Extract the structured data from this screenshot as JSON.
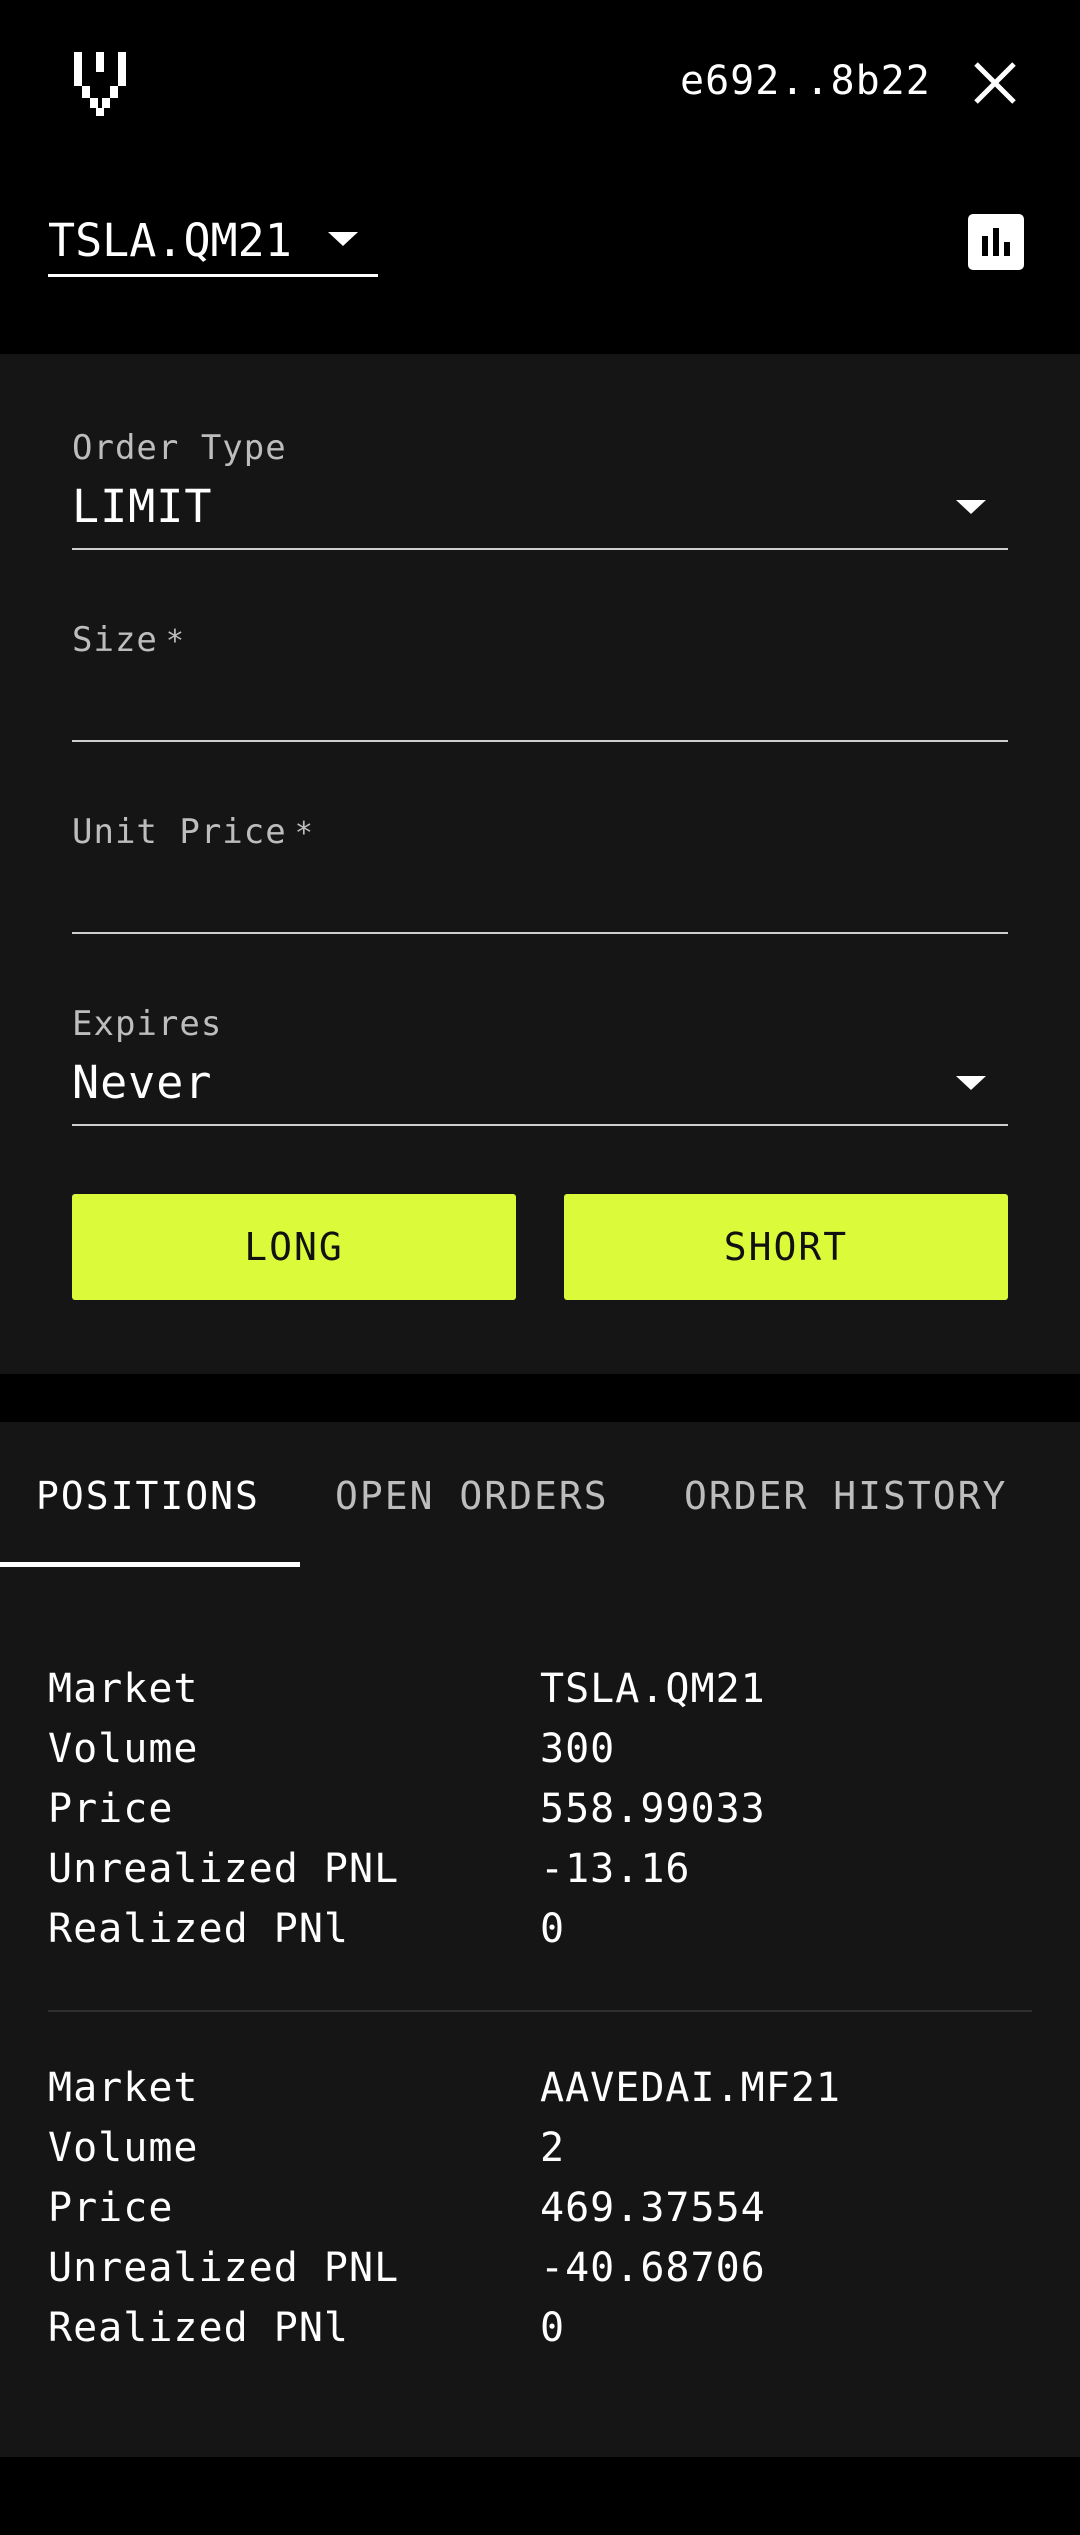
{
  "header": {
    "logo_icon": "pixel-v-logo",
    "wallet_address": "e692..8b22",
    "close_icon": "close-icon"
  },
  "market": {
    "selected": "TSLA.QM21",
    "chart_icon": "bar-chart-icon"
  },
  "order_form": {
    "order_type": {
      "label": "Order Type",
      "value": "LIMIT"
    },
    "size": {
      "label": "Size",
      "required_mark": "*",
      "value": ""
    },
    "unit_price": {
      "label": "Unit Price",
      "required_mark": "*",
      "value": ""
    },
    "expires": {
      "label": "Expires",
      "value": "Never"
    },
    "long_label": "LONG",
    "short_label": "SHORT",
    "accent_color": "#dbfb3a"
  },
  "tabs": [
    {
      "label": "POSITIONS",
      "active": true
    },
    {
      "label": "OPEN ORDERS",
      "active": false
    },
    {
      "label": "ORDER HISTORY",
      "active": false
    }
  ],
  "positions": [
    {
      "market_label": "Market",
      "market": "TSLA.QM21",
      "volume_label": "Volume",
      "volume": "300",
      "price_label": "Price",
      "price": "558.99033",
      "unrealized_label": "Unrealized PNL",
      "unrealized": "-13.16",
      "realized_label": "Realized PNl",
      "realized": "0"
    },
    {
      "market_label": "Market",
      "market": "AAVEDAI.MF21",
      "volume_label": "Volume",
      "volume": "2",
      "price_label": "Price",
      "price": "469.37554",
      "unrealized_label": "Unrealized PNL",
      "unrealized": "-40.68706",
      "realized_label": "Realized PNl",
      "realized": "0"
    }
  ]
}
